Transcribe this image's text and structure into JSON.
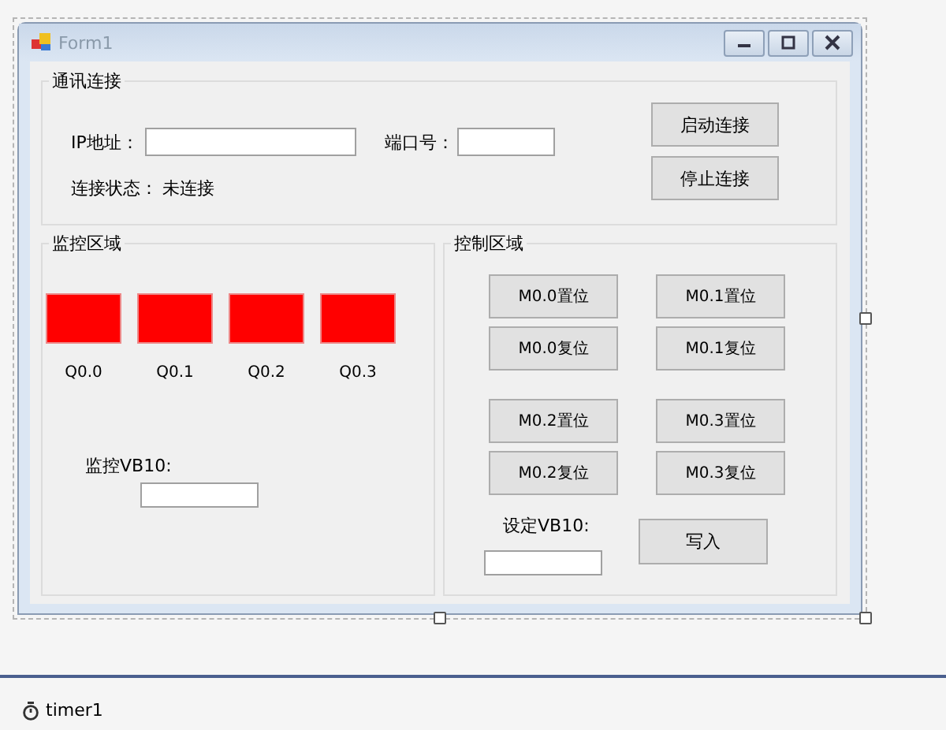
{
  "window": {
    "title": "Form1"
  },
  "connection_group": {
    "title": "通讯连接",
    "ip_label": "IP地址：",
    "port_label": "端口号：",
    "status_label": "连接状态：",
    "status_value": "未连接",
    "buttons": [
      "启动连接",
      "停止连接"
    ]
  },
  "monitor_group": {
    "title": "监控区域",
    "lamps": [
      {
        "label": "Q0.0",
        "color": "#ff0000"
      },
      {
        "label": "Q0.1",
        "color": "#ff0000"
      },
      {
        "label": "Q0.2",
        "color": "#ff0000"
      },
      {
        "label": "Q0.3",
        "color": "#ff0000"
      }
    ],
    "vb_label": "监控VB10:"
  },
  "control_group": {
    "title": "控制区域",
    "button_blocks": [
      [
        "M0.0置位",
        "M0.1置位",
        "M0.0复位",
        "M0.1复位"
      ],
      [
        "M0.2置位",
        "M0.3置位",
        "M0.2复位",
        "M0.3复位"
      ]
    ],
    "vb_label": "设定VB10:",
    "write_button": "写入"
  },
  "component_tray": [
    {
      "kind": "timer",
      "name": "timer1"
    }
  ]
}
